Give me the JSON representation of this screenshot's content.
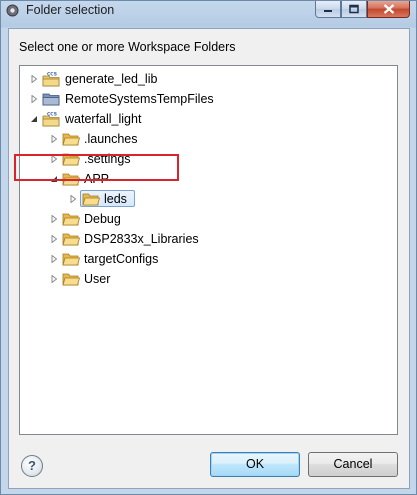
{
  "window": {
    "title": "Folder selection"
  },
  "dialog": {
    "prompt": "Select one or more Workspace Folders",
    "tree": [
      {
        "label": "generate_led_lib",
        "level": 0,
        "expanded": false,
        "type": "project"
      },
      {
        "label": "RemoteSystemsTempFiles",
        "level": 0,
        "expanded": false,
        "type": "project-plain"
      },
      {
        "label": "waterfall_light",
        "level": 0,
        "expanded": true,
        "type": "project"
      },
      {
        "label": ".launches",
        "level": 1,
        "expanded": false,
        "type": "folder"
      },
      {
        "label": ".settings",
        "level": 1,
        "expanded": false,
        "type": "folder"
      },
      {
        "label": "APP",
        "level": 1,
        "expanded": true,
        "type": "folder"
      },
      {
        "label": "leds",
        "level": 2,
        "expanded": false,
        "type": "folder",
        "selected": true
      },
      {
        "label": "Debug",
        "level": 1,
        "expanded": false,
        "type": "folder"
      },
      {
        "label": "DSP2833x_Libraries",
        "level": 1,
        "expanded": false,
        "type": "folder"
      },
      {
        "label": "targetConfigs",
        "level": 1,
        "expanded": false,
        "type": "folder"
      },
      {
        "label": "User",
        "level": 1,
        "expanded": false,
        "type": "folder"
      }
    ]
  },
  "buttons": {
    "help": "?",
    "ok": "OK",
    "cancel": "Cancel"
  },
  "colors": {
    "highlight_box": "#d9232d",
    "selection_border": "#7da2ce"
  },
  "icons": {
    "title": "eclipse-gear-icon",
    "project": "ccs-project-icon",
    "folder": "folder-icon"
  }
}
